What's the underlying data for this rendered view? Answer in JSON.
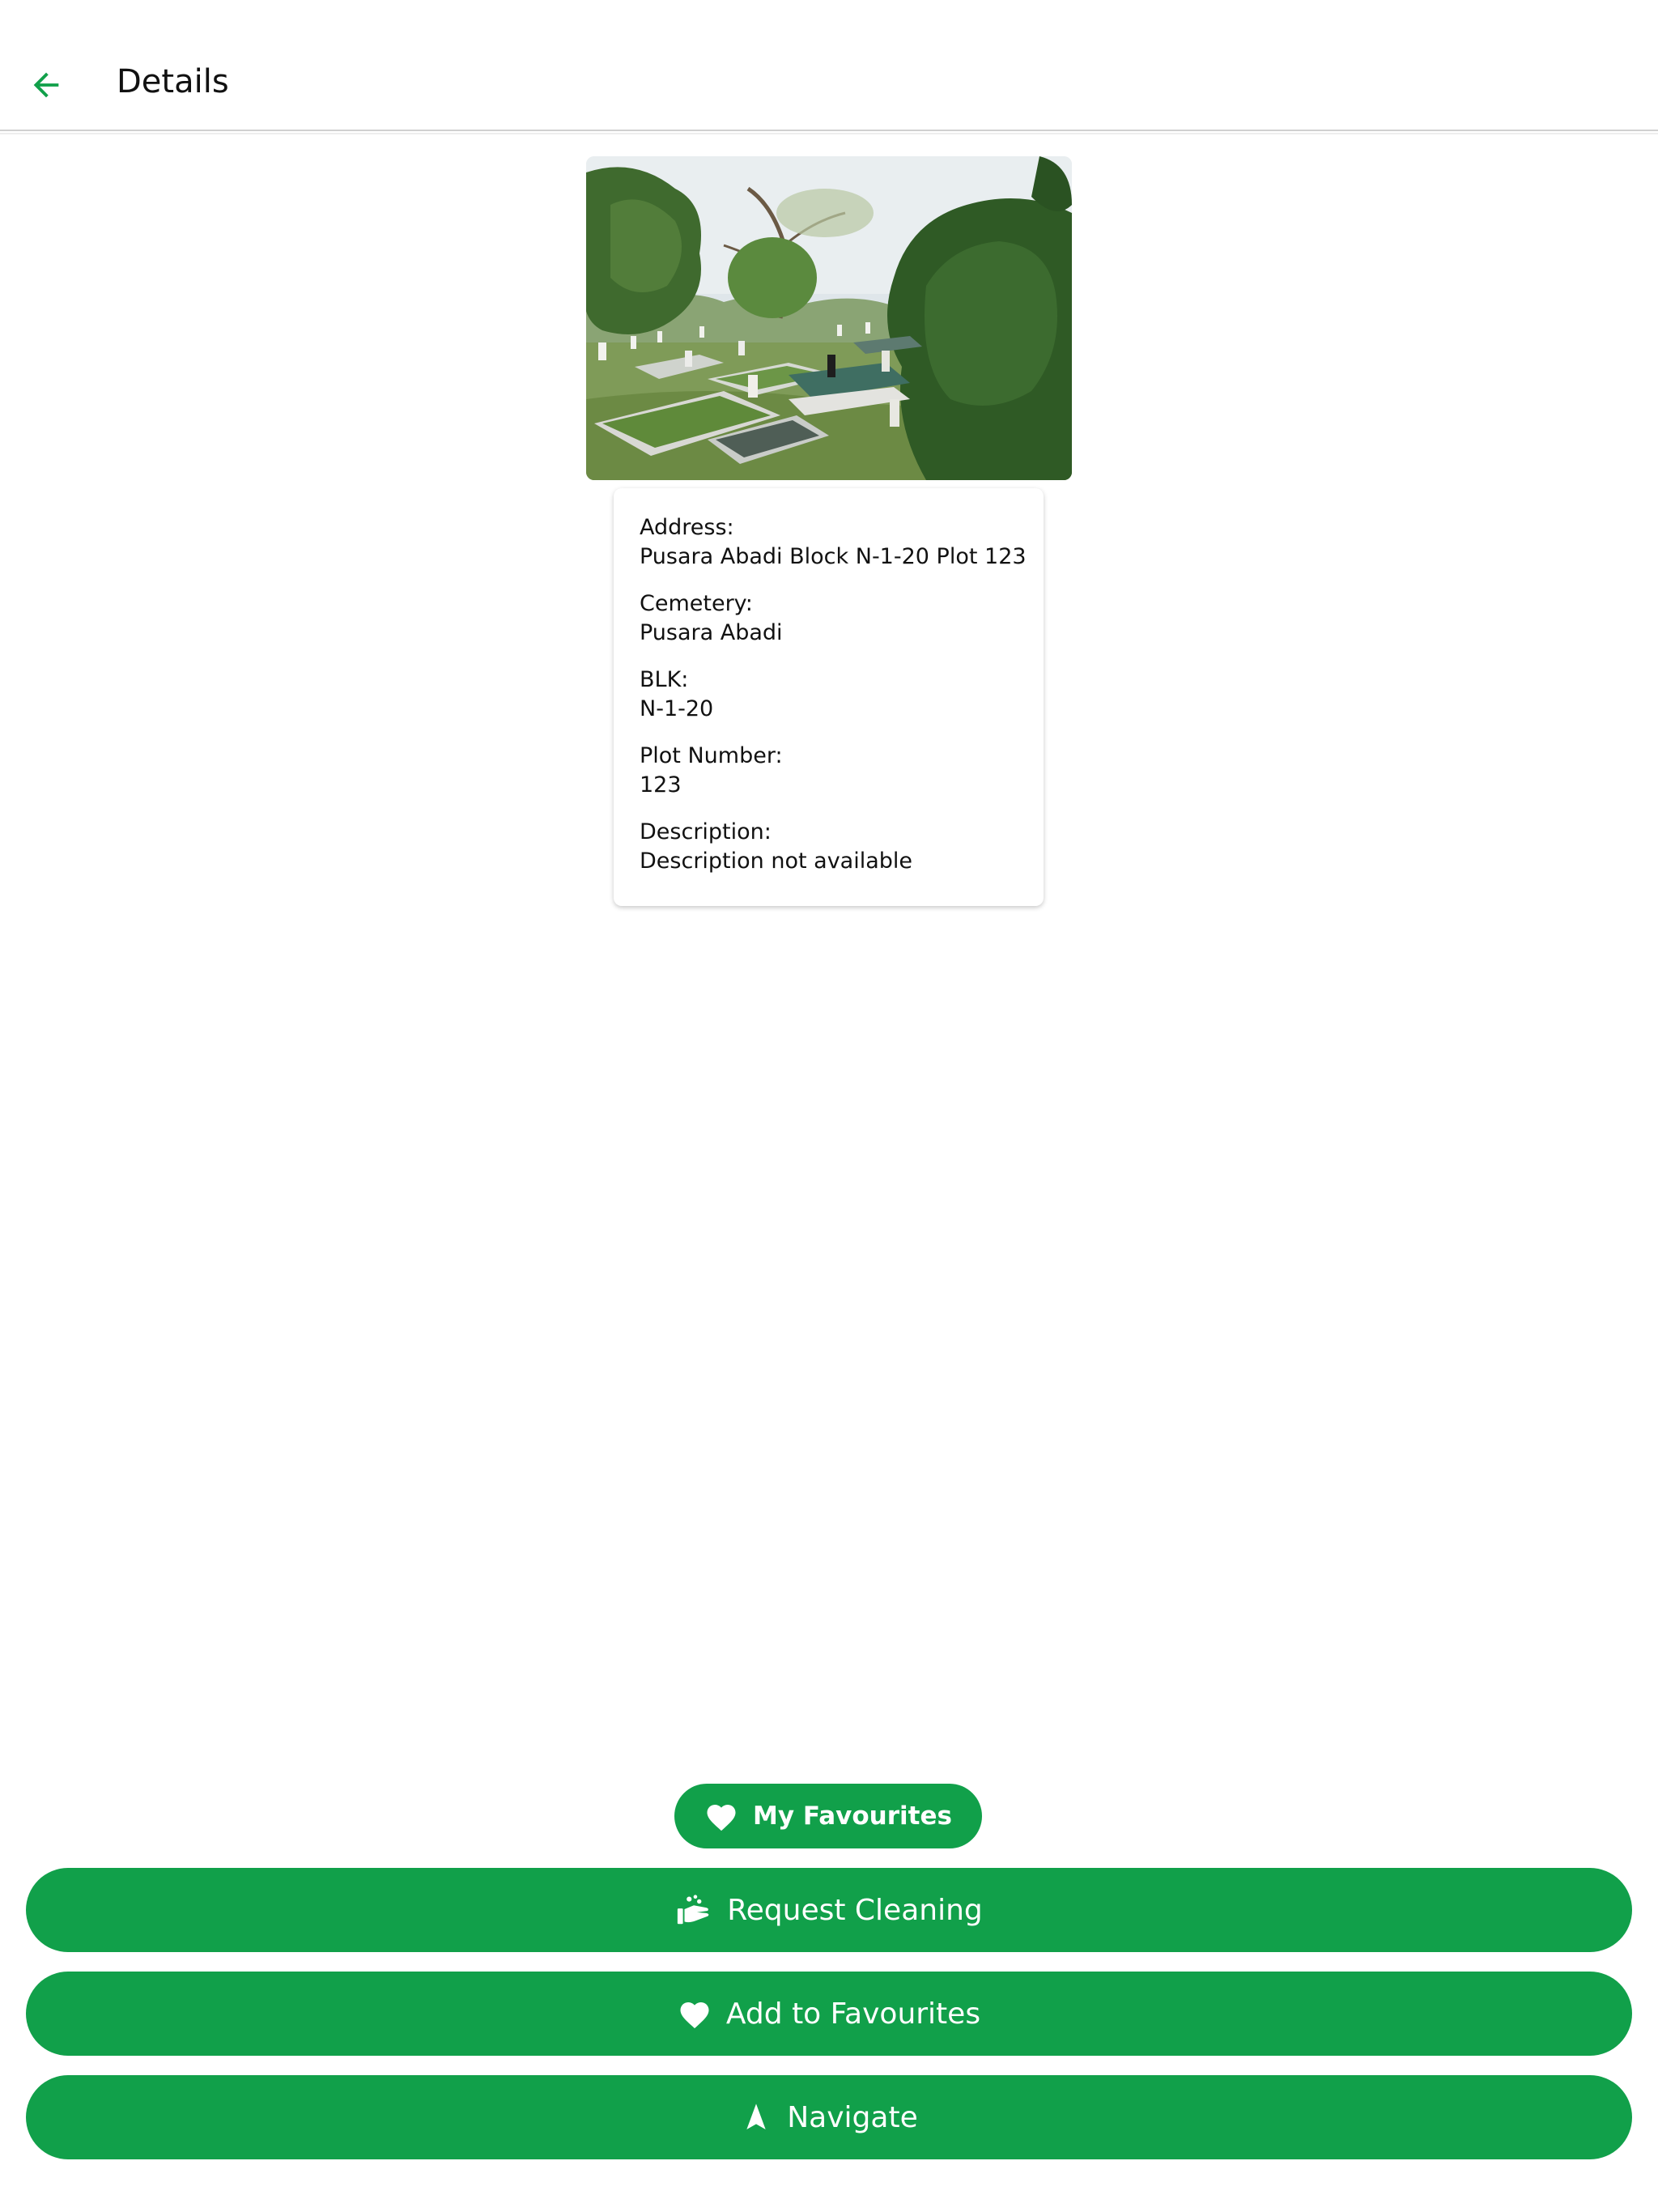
{
  "header": {
    "title": "Details",
    "back_icon": "arrow-left-icon",
    "accent_color": "#11a04a"
  },
  "photo": {
    "alt": "Cemetery photo"
  },
  "details": {
    "address_label": "Address:",
    "address_value": "Pusara Abadi Block N-1-20 Plot 123",
    "cemetery_label": "Cemetery:",
    "cemetery_value": "Pusara Abadi",
    "blk_label": "BLK:",
    "blk_value": "N-1-20",
    "plot_label": "Plot Number:",
    "plot_value": "123",
    "description_label": "Description:",
    "description_value": "Description not available"
  },
  "actions": {
    "my_favourites_label": "My Favourites",
    "request_cleaning_label": "Request Cleaning",
    "add_favourites_label": "Add to Favourites",
    "navigate_label": "Navigate",
    "button_color": "#11a04a"
  }
}
